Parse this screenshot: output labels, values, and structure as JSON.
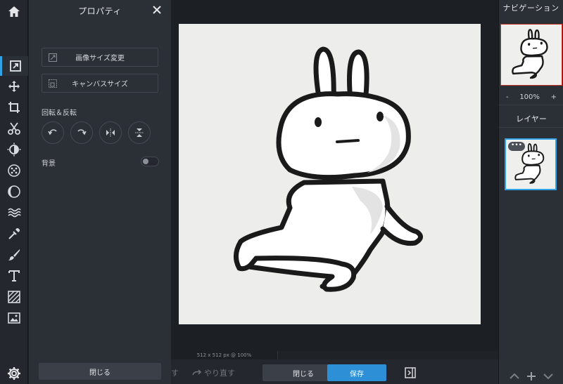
{
  "properties": {
    "title": "プロパティ",
    "resize_label": "画像サイズ変更",
    "canvas_size_label": "キャンバスサイズ",
    "rotate_flip_label": "回転＆反転",
    "background_label": "背景",
    "close_label": "閉じる"
  },
  "canvas": {
    "info": "512 x 512 px @ 100%"
  },
  "bottom": {
    "undo_label": "す",
    "redo_label": "やり直す",
    "close_label": "閉じる",
    "save_label": "保存"
  },
  "navigator": {
    "title": "ナビゲーション",
    "zoom_level": "100%",
    "zoom_out": "-",
    "zoom_in": "+"
  },
  "layers": {
    "title": "レイヤー",
    "menu_dots": "•••"
  },
  "icons": {
    "home": "home-icon",
    "properties": "properties-icon",
    "move": "move-icon",
    "crop": "crop-icon",
    "cut": "scissors-icon",
    "adjust": "adjust-icon",
    "effects": "effects-icon",
    "liquify": "liquify-icon",
    "texture": "wave-icon",
    "dropper": "dropper-icon",
    "brush": "brush-icon",
    "text": "text-icon",
    "pattern": "pattern-icon",
    "image": "image-icon",
    "settings": "gear-icon"
  },
  "colors": {
    "accent": "#2fa3e6",
    "save": "#2d8fd5",
    "nav_frame": "#c8392b"
  }
}
